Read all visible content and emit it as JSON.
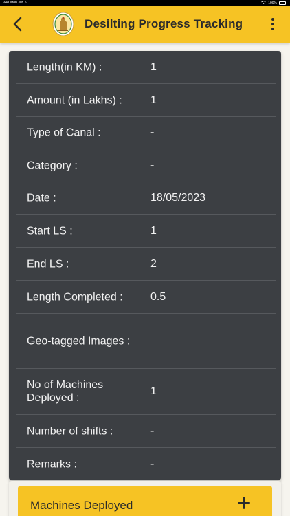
{
  "status_bar": {
    "time": "9:41",
    "date": "Mon Jun 5",
    "battery": "100%"
  },
  "app_bar": {
    "title": "Desilting Progress Tracking",
    "back_icon": "chevron-left-icon",
    "menu_icon": "more-vertical-icon",
    "logo": "state-emblem",
    "color": "#f6c324"
  },
  "details": [
    {
      "label": "Length(in KM) :",
      "value": "1"
    },
    {
      "label": "Amount (in Lakhs) :",
      "value": "1"
    },
    {
      "label": "Type of Canal :",
      "value": "-"
    },
    {
      "label": "Category :",
      "value": "-"
    },
    {
      "label": "Date :",
      "value": "18/05/2023"
    },
    {
      "label": "Start LS :",
      "value": "1"
    },
    {
      "label": "End LS :",
      "value": "2"
    },
    {
      "label": "Length Completed :",
      "value": "0.5"
    },
    {
      "label": "Geo-tagged Images :",
      "value": ""
    },
    {
      "label": "No of Machines Deployed :",
      "value": "1"
    },
    {
      "label": "Number of shifts :",
      "value": "-"
    },
    {
      "label": "Remarks :",
      "value": "-"
    }
  ],
  "machines_section": {
    "label": "Machines Deployed",
    "icon": "plus-icon"
  },
  "colors": {
    "card_bg": "#3c3f43",
    "accent": "#f6c324",
    "text": "#f1f1f1"
  }
}
